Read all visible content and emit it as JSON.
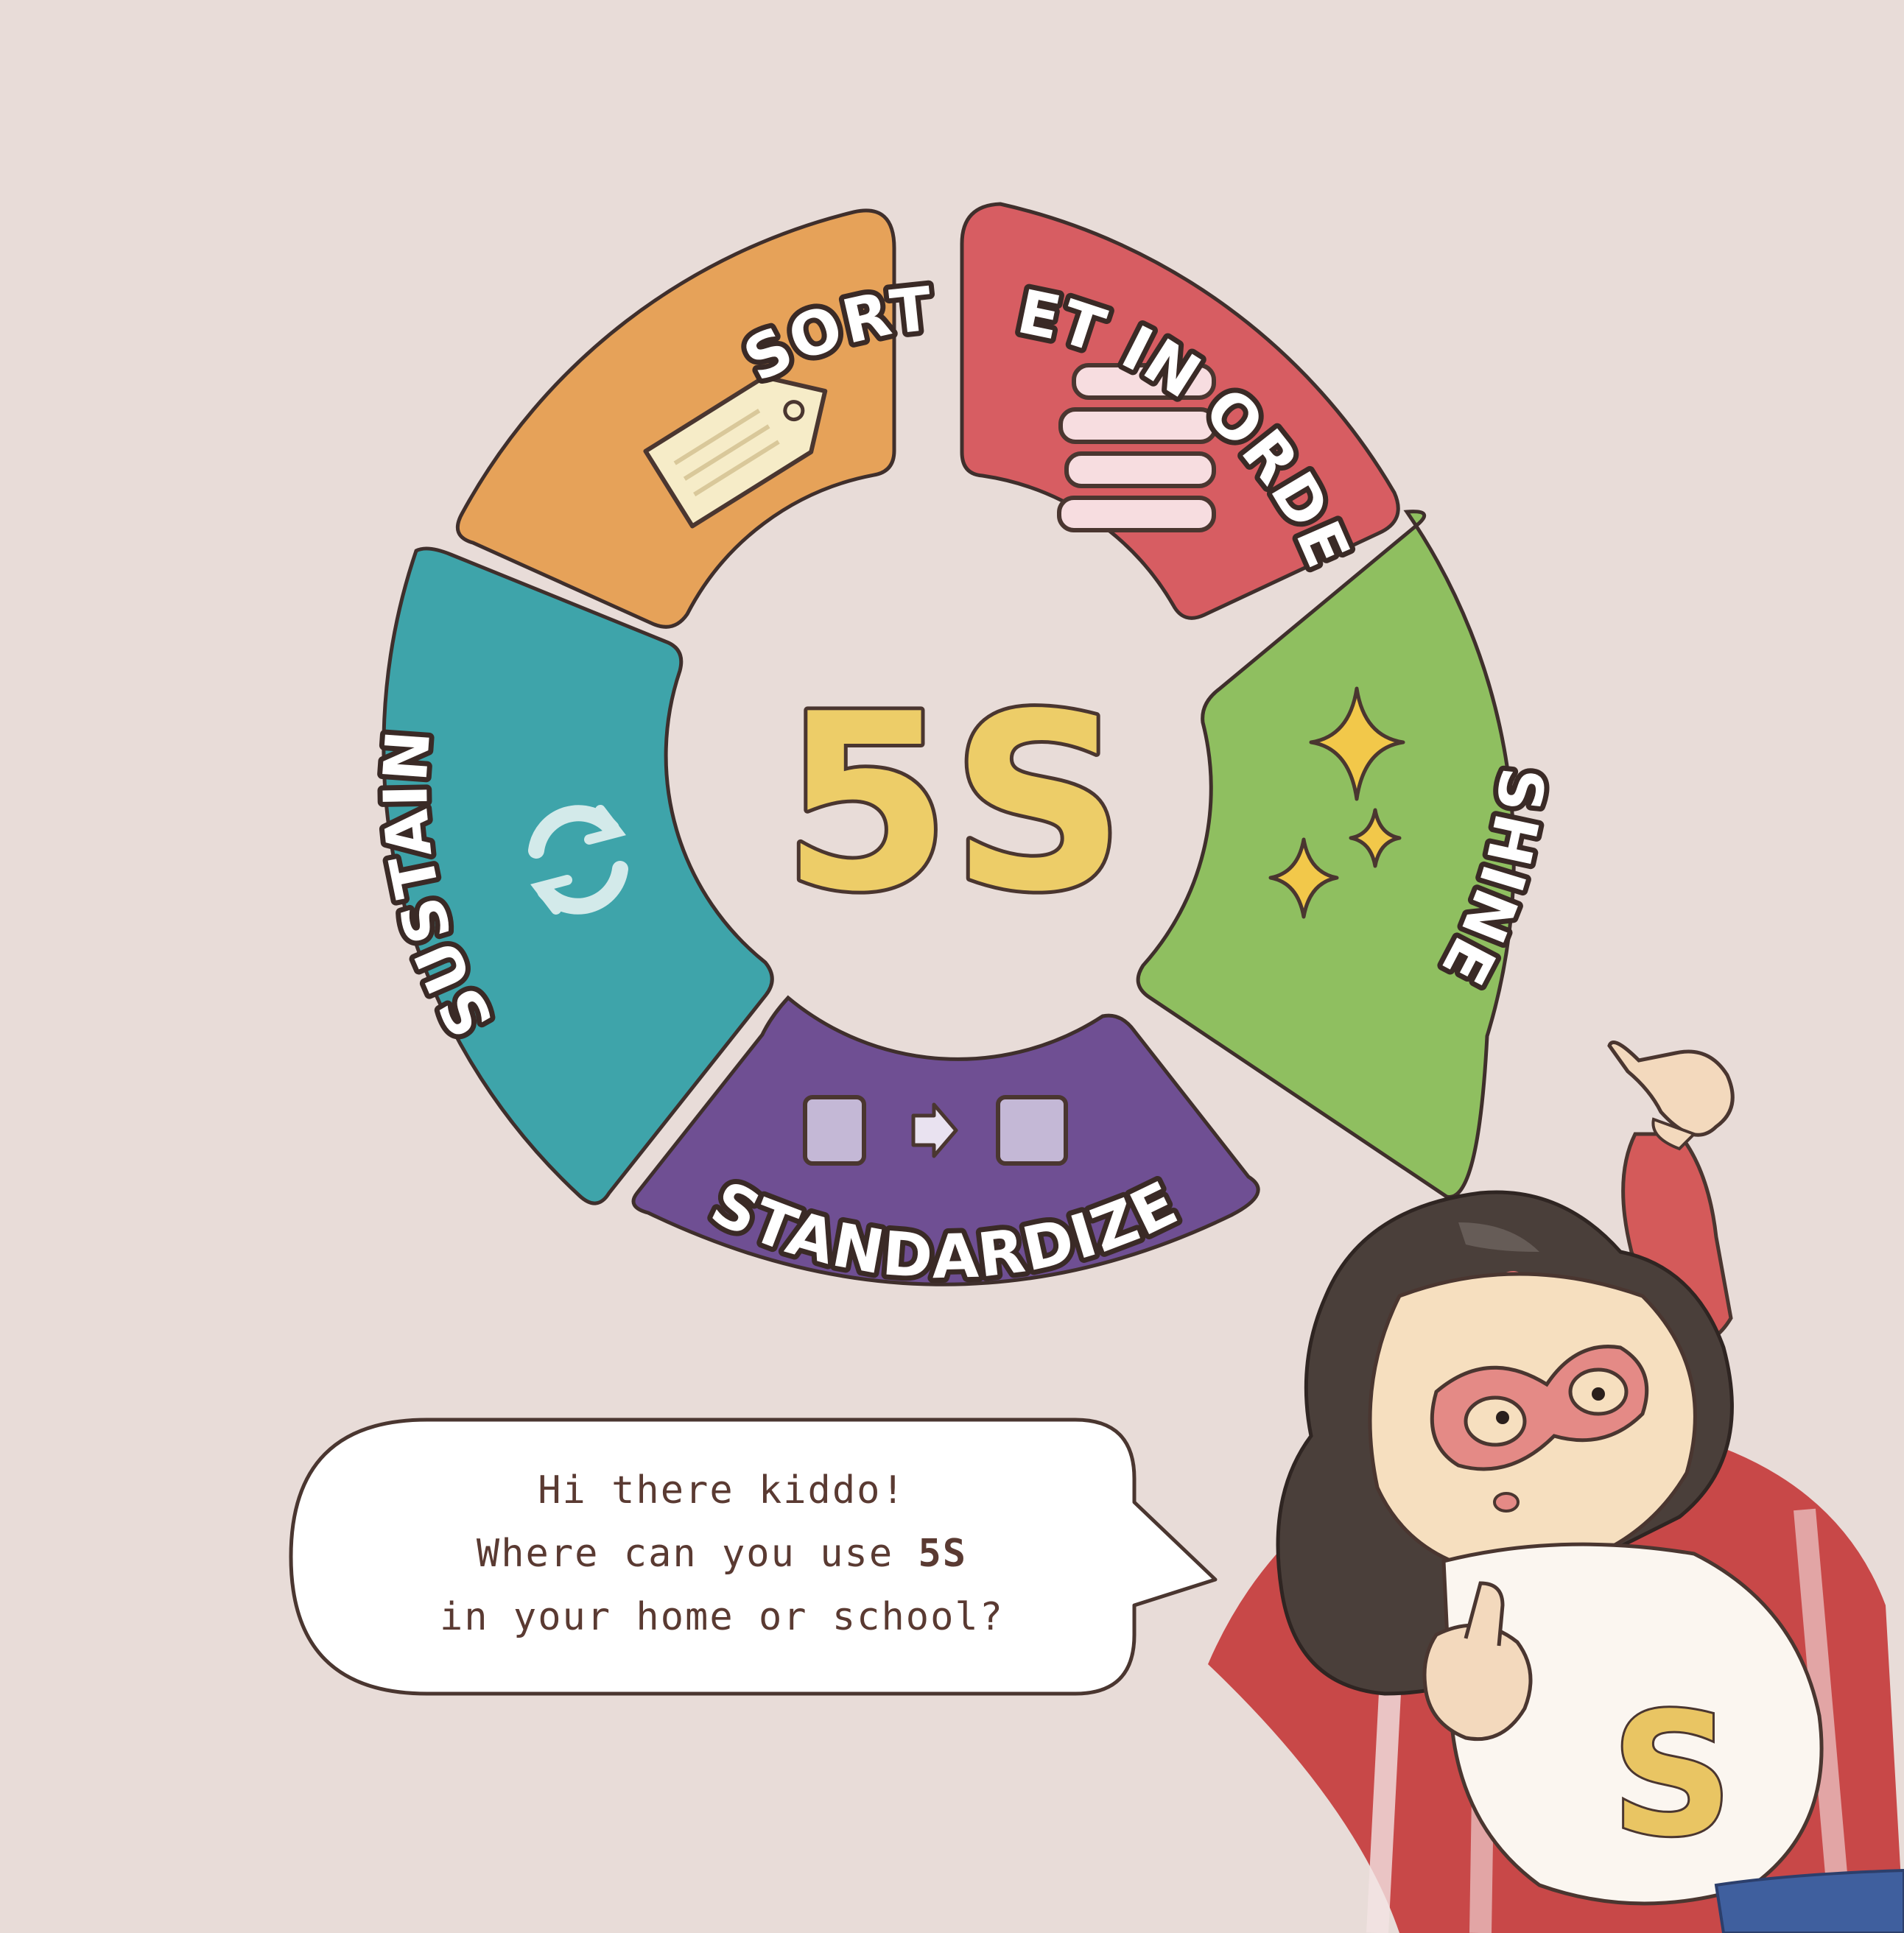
{
  "diagram": {
    "center_label": "5S",
    "segments": [
      {
        "id": "sort",
        "label": "SORT",
        "color": "#e6a259",
        "icon": "tag-icon"
      },
      {
        "id": "set-in-order",
        "label": "SET IN ORDER",
        "color": "#d75d62",
        "icon": "stacked-bars-icon"
      },
      {
        "id": "shine",
        "label": "SHINE",
        "color": "#8fbf60",
        "icon": "sparkle-icon"
      },
      {
        "id": "standardize",
        "label": "STANDARDIZE",
        "color": "#6f4f93",
        "icon": "square-arrow-square-icon"
      },
      {
        "id": "sustain",
        "label": "SUSTAIN",
        "color": "#3ea4aa",
        "icon": "cycle-arrows-icon"
      }
    ]
  },
  "speech_bubble": {
    "line1": "Hi there kiddo!",
    "line2_prefix": "Where can you use ",
    "line2_bold": "5S",
    "line3": "in your home or school?"
  },
  "character": {
    "shirt_emblem": "S"
  }
}
